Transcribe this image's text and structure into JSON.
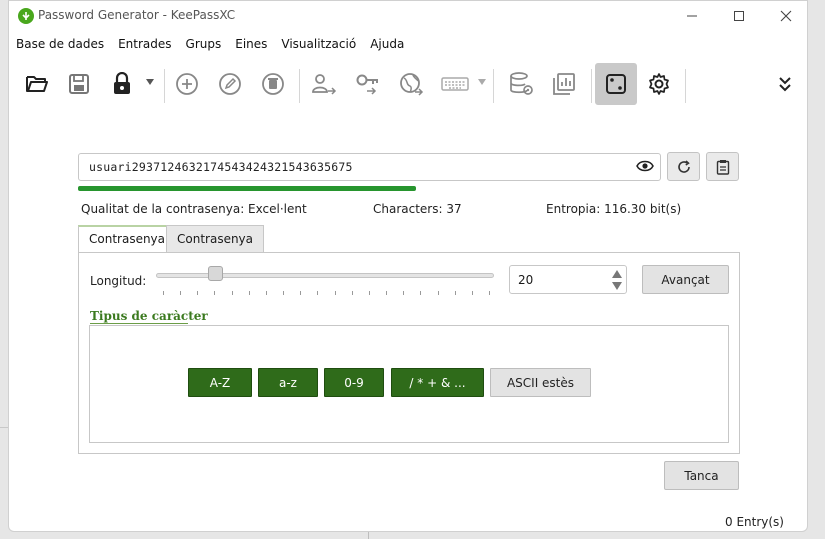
{
  "window": {
    "title": "Password Generator - KeePassXC"
  },
  "menu": [
    "Base de dades",
    "Entrades",
    "Grups",
    "Eines",
    "Visualització",
    "Ajuda"
  ],
  "toolbar": {
    "icons": [
      "open-folder-icon",
      "save-icon",
      "lock-icon",
      "add-entry-icon",
      "edit-entry-icon",
      "delete-entry-icon",
      "copy-username-icon",
      "copy-password-icon",
      "copy-url-icon",
      "autotype-keyboard-icon",
      "database-settings-icon",
      "reports-icon",
      "password-generator-icon",
      "settings-icon",
      "more-icon"
    ]
  },
  "password": {
    "value": "usuari29371246321745434243215436356​75"
  },
  "stats": {
    "quality": "Qualitat de la contrasenya: Excel·lent",
    "characters": "Characters: 37",
    "entropy": "Entropia: 116.30 bit(s)",
    "strength_fraction": 0.58
  },
  "tabs": [
    {
      "label": "Contrasenya"
    },
    {
      "label": "Contrasenya"
    }
  ],
  "length": {
    "label": "Longitud:",
    "value": "20",
    "slider_fraction": 0.16
  },
  "advanced_button": "Avançat",
  "char_types": {
    "title": "Tipus de caràcter",
    "toggles": [
      {
        "label": "A-Z",
        "on": true
      },
      {
        "label": "a-z",
        "on": true
      },
      {
        "label": "0-9",
        "on": true
      },
      {
        "label": "/ * + & ...",
        "on": true
      },
      {
        "label": "ASCII estès",
        "on": false
      }
    ]
  },
  "close_button": "Tanca",
  "status": "0 Entry(s)",
  "colors": {
    "accent": "#2f6b1a",
    "strength": "#27952e",
    "group_title": "#3b7a1f"
  }
}
